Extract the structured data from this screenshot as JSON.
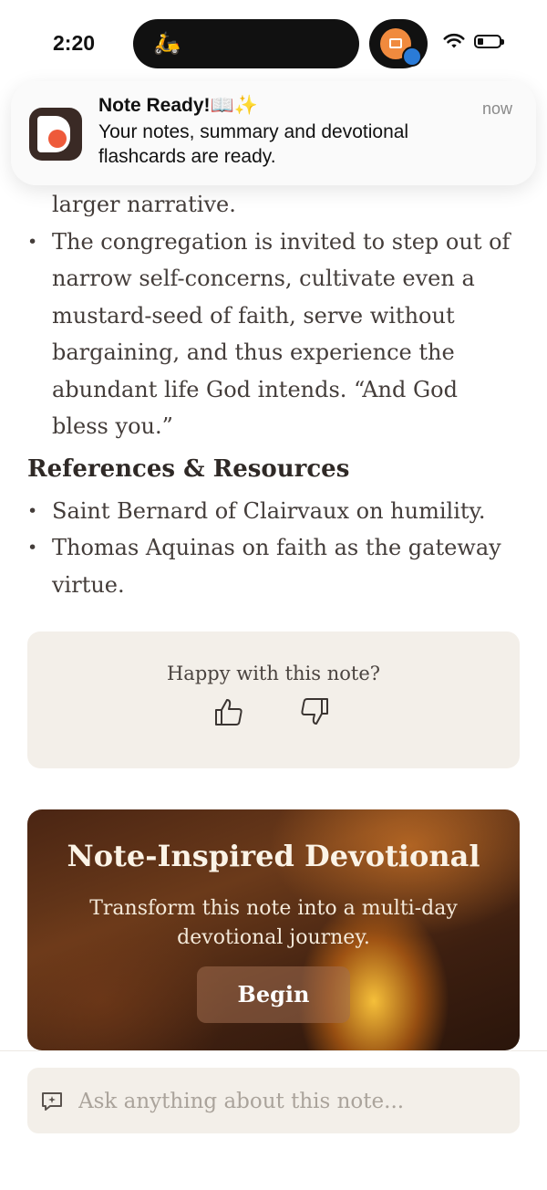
{
  "status_bar": {
    "time": "2:20"
  },
  "notification": {
    "title": "Note Ready!📖✨",
    "body": "Your notes, summary and devotional flashcards are ready.",
    "time": "now"
  },
  "article": {
    "lines": [
      "larger narrative."
    ],
    "bullet_main_lines": [
      "The congregation is invited to step out of",
      "narrow self-concerns, cultivate even a",
      "mustard-seed of faith, serve without",
      "bargaining, and thus experience the",
      "abundant life God intends. “And God",
      "bless you.”"
    ],
    "references_heading": "References & Resources",
    "references": [
      {
        "line1": "Saint Bernard of Clairvaux on humility.",
        "line2": ""
      },
      {
        "line1": "Thomas Aquinas on faith as the gateway",
        "line2": "virtue."
      }
    ]
  },
  "feedback": {
    "question": "Happy with this note?"
  },
  "devotional": {
    "title": "Note-Inspired Devotional",
    "description": "Transform this note into a multi-day devotional journey.",
    "button_label": "Begin"
  },
  "ask": {
    "placeholder": "Ask anything about this note..."
  },
  "icons": {
    "island": "scooter-delivery-icon",
    "thumbs_up": "thumbs-up-icon",
    "thumbs_down": "thumbs-down-icon",
    "ask": "chat-sparkle-icon"
  },
  "colors": {
    "background": "#ffffff",
    "card": "#f3efe9",
    "text": "#443d3a",
    "accent_orange": "#ee5a3a"
  }
}
